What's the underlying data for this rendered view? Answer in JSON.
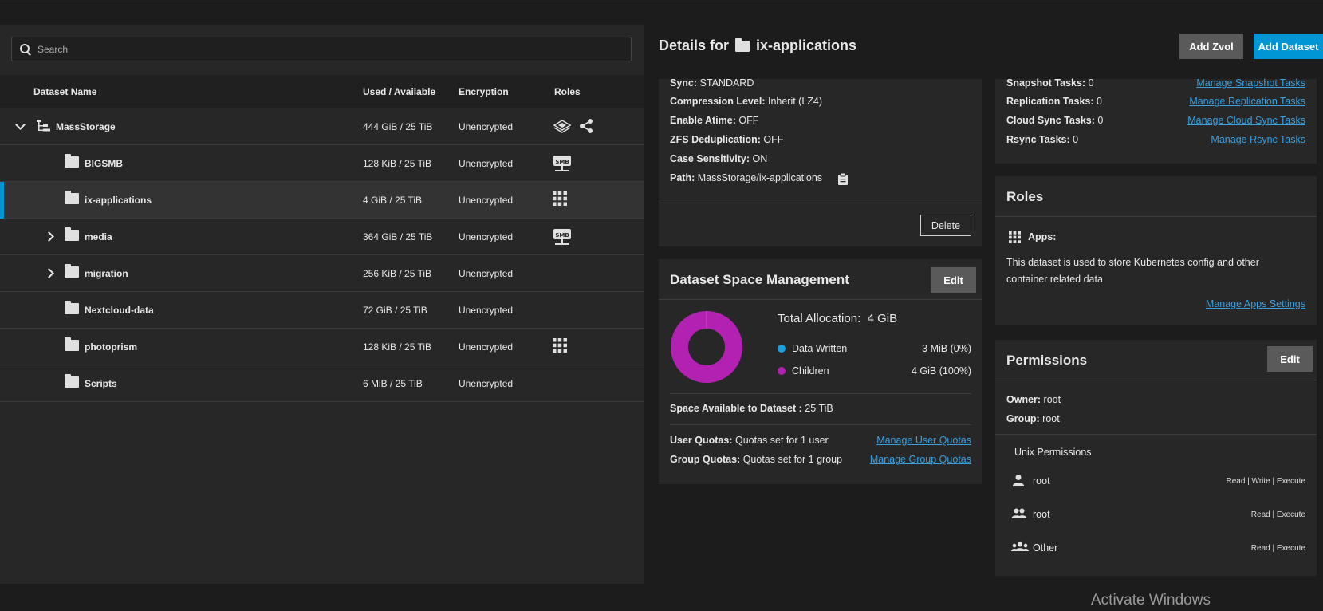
{
  "search": {
    "placeholder": "Search"
  },
  "table": {
    "headers": {
      "name": "Dataset Name",
      "used": "Used / Available",
      "encryption": "Encryption",
      "roles": "Roles"
    },
    "rows": [
      {
        "name": "MassStorage",
        "used": "444 GiB / 25 TiB",
        "encryption": "Unencrypted",
        "expander": "chevron-down",
        "icon": "dataset-tree-icon",
        "roles": [
          "dataset-layers-icon",
          "share-icon"
        ]
      },
      {
        "name": "BIGSMB",
        "used": "128 KiB / 25 TiB",
        "encryption": "Unencrypted",
        "expander": "",
        "icon": "folder-icon",
        "roles": [
          "smb-share-icon"
        ]
      },
      {
        "name": "ix-applications",
        "used": "4 GiB / 25 TiB",
        "encryption": "Unencrypted",
        "expander": "",
        "icon": "folder-icon",
        "roles": [
          "apps-grid-icon"
        ],
        "selected": true
      },
      {
        "name": "media",
        "used": "364 GiB / 25 TiB",
        "encryption": "Unencrypted",
        "expander": "chevron-right",
        "icon": "folder-icon",
        "roles": [
          "smb-share-icon"
        ]
      },
      {
        "name": "migration",
        "used": "256 KiB / 25 TiB",
        "encryption": "Unencrypted",
        "expander": "chevron-right",
        "icon": "folder-icon",
        "roles": []
      },
      {
        "name": "Nextcloud-data",
        "used": "72 GiB / 25 TiB",
        "encryption": "Unencrypted",
        "expander": "",
        "icon": "folder-icon",
        "roles": []
      },
      {
        "name": "photoprism",
        "used": "128 KiB / 25 TiB",
        "encryption": "Unencrypted",
        "expander": "",
        "icon": "folder-icon",
        "roles": [
          "apps-grid-icon"
        ]
      },
      {
        "name": "Scripts",
        "used": "6 MiB / 25 TiB",
        "encryption": "Unencrypted",
        "expander": "",
        "icon": "folder-icon",
        "roles": []
      }
    ]
  },
  "details": {
    "title_prefix": "Details for",
    "title_name": "ix-applications",
    "add_zvol": "Add Zvol",
    "add_dataset": "Add Dataset"
  },
  "overview": {
    "sync_label": "Sync:",
    "sync_value": "STANDARD",
    "compression_label": "Compression Level:",
    "compression_value": "Inherit (LZ4)",
    "atime_label": "Enable Atime:",
    "atime_value": "OFF",
    "dedup_label": "ZFS Deduplication:",
    "dedup_value": "OFF",
    "case_label": "Case Sensitivity:",
    "case_value": "ON",
    "path_label": "Path:",
    "path_value": "MassStorage/ix-applications",
    "delete": "Delete"
  },
  "space": {
    "title": "Dataset Space Management",
    "edit": "Edit",
    "total_label": "Total Allocation:",
    "total_value": "4 GiB",
    "legend": [
      {
        "label": "Data Written",
        "value": "3 MiB (0%)",
        "color": "#1aa0e0",
        "percent": 0
      },
      {
        "label": "Children",
        "value": "4 GiB (100%)",
        "color": "#b321b3",
        "percent": 100
      }
    ],
    "available_label": "Space Available to Dataset :",
    "available_value": "25 TiB",
    "user_quotas_label": "User Quotas:",
    "user_quotas_value": "Quotas set for 1 user",
    "manage_user_quotas": "Manage User Quotas",
    "group_quotas_label": "Group Quotas:",
    "group_quotas_value": "Quotas set for 1 group",
    "manage_group_quotas": "Manage Group Quotas"
  },
  "tasks": {
    "snapshot_label": "Snapshot Tasks:",
    "snapshot_value": "0",
    "manage_snapshot": "Manage Snapshot Tasks",
    "replication_label": "Replication Tasks:",
    "replication_value": "0",
    "manage_replication": "Manage Replication Tasks",
    "cloud_label": "Cloud Sync Tasks:",
    "cloud_value": "0",
    "manage_cloud": "Manage Cloud Sync Tasks",
    "rsync_label": "Rsync Tasks:",
    "rsync_value": "0",
    "manage_rsync": "Manage Rsync Tasks"
  },
  "roles": {
    "title": "Roles",
    "apps_label": "Apps:",
    "description": "This dataset is used to store Kubernetes config and other container related data",
    "manage_apps": "Manage Apps Settings"
  },
  "permissions": {
    "title": "Permissions",
    "edit": "Edit",
    "owner_label": "Owner:",
    "owner_value": "root",
    "group_label": "Group:",
    "group_value": "root",
    "unix_title": "Unix Permissions",
    "entries": [
      {
        "name": "root",
        "perms": "Read | Write | Execute",
        "icon": "user-icon"
      },
      {
        "name": "root",
        "perms": "Read | Execute",
        "icon": "group-icon"
      },
      {
        "name": "Other",
        "perms": "Read | Execute",
        "icon": "other-users-icon"
      }
    ]
  },
  "watermark": "Activate Windows"
}
